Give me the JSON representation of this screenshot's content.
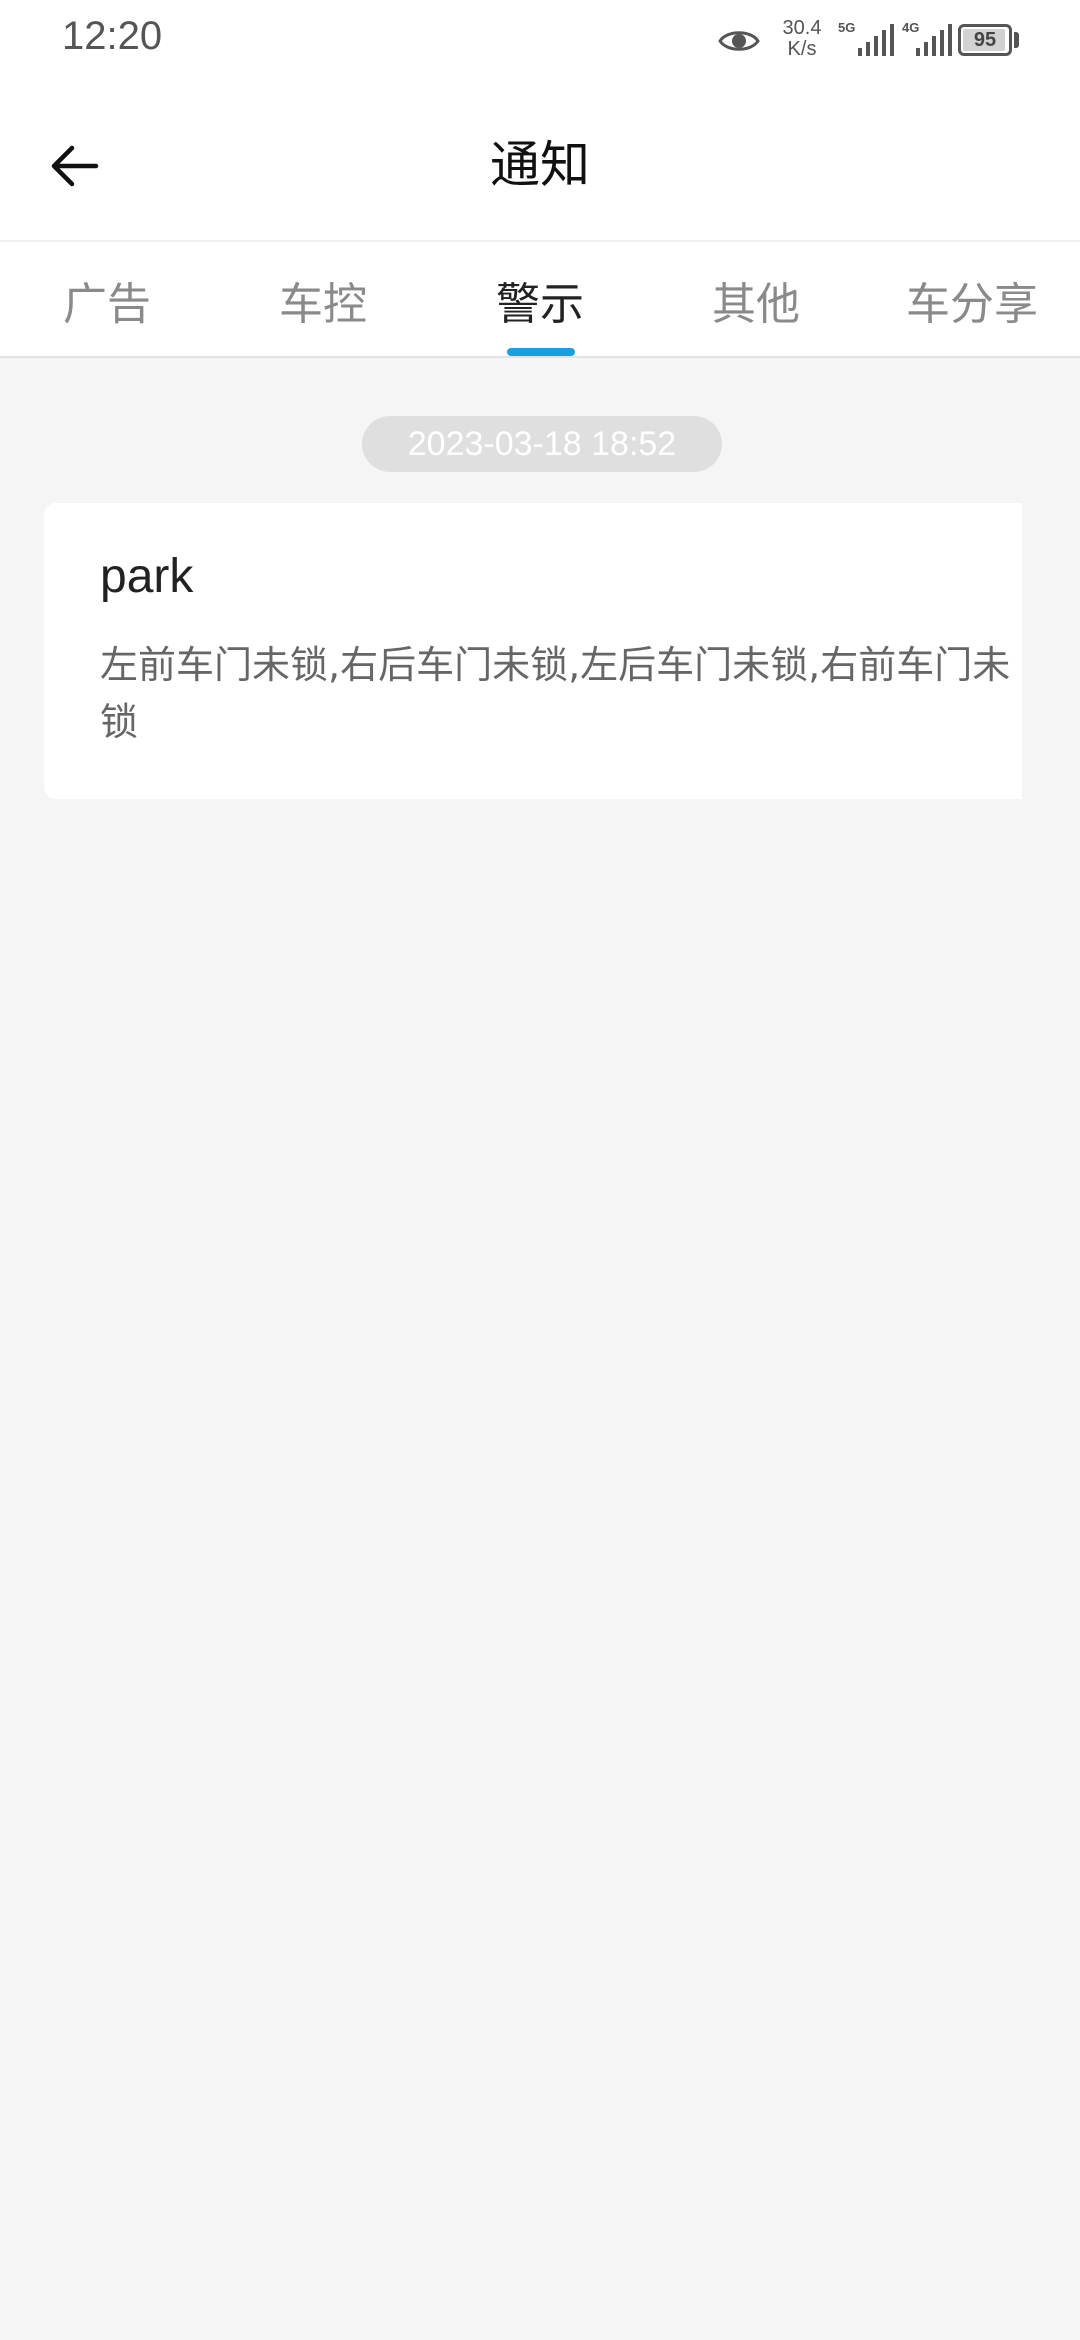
{
  "status_bar": {
    "time": "12:20",
    "net_speed_value": "30.4",
    "net_speed_unit": "K/s",
    "sim1_label": "5G",
    "sim2_label": "4G",
    "battery": "95",
    "battery_level_percent": 95
  },
  "header": {
    "title": "通知"
  },
  "tabs": [
    {
      "label": "广告",
      "active": false
    },
    {
      "label": "车控",
      "active": false
    },
    {
      "label": "警示",
      "active": true
    },
    {
      "label": "其他",
      "active": false
    },
    {
      "label": "车分享",
      "active": false
    }
  ],
  "colors": {
    "accent": "#1a9fde",
    "background": "#f5f5f5"
  },
  "notifications": [
    {
      "timestamp": "2023-03-18 18:52",
      "title": "park",
      "body": "左前车门未锁,右后车门未锁,左后车门未锁,右前车门未锁"
    }
  ]
}
